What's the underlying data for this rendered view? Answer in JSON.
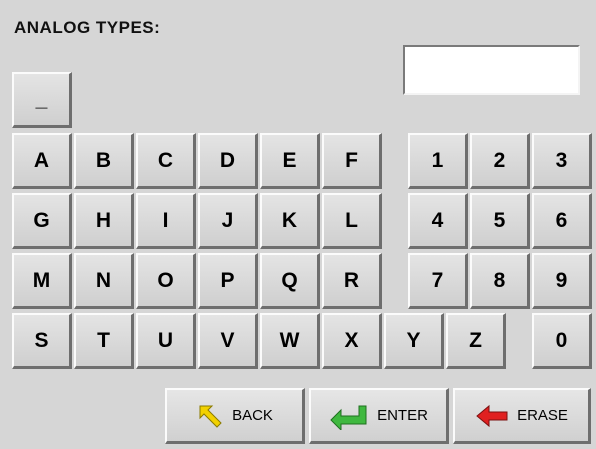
{
  "header": {
    "title": "ANALOG TYPES:"
  },
  "display": {
    "value": ""
  },
  "keys": {
    "underscore": "_",
    "row1": [
      "A",
      "B",
      "C",
      "D",
      "E",
      "F"
    ],
    "row2": [
      "G",
      "H",
      "I",
      "J",
      "K",
      "L"
    ],
    "row3": [
      "M",
      "N",
      "O",
      "P",
      "Q",
      "R"
    ],
    "row4": [
      "S",
      "T",
      "U",
      "V",
      "W",
      "X",
      "Y",
      "Z"
    ],
    "num1": [
      "1",
      "2",
      "3"
    ],
    "num2": [
      "4",
      "5",
      "6"
    ],
    "num3": [
      "7",
      "8",
      "9"
    ],
    "zero": "0"
  },
  "actions": {
    "back": {
      "label": "BACK",
      "icon": "back-arrow-icon",
      "color": "#f2d100"
    },
    "enter": {
      "label": "ENTER",
      "icon": "enter-arrow-icon",
      "color": "#3fb83f"
    },
    "erase": {
      "label": "ERASE",
      "icon": "erase-arrow-icon",
      "color": "#e02020"
    }
  }
}
